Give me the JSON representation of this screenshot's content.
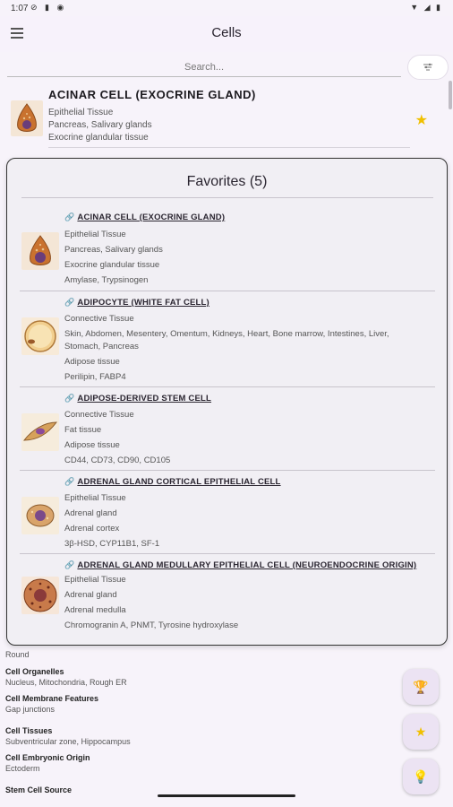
{
  "status_bar": {
    "time": "1:07"
  },
  "app_bar": {
    "title": "Cells",
    "menu_icon": "menu-icon"
  },
  "search": {
    "placeholder": "Search...",
    "filter_icon": "filter-icon"
  },
  "current_cell": {
    "name": "ACINAR CELL (EXOCRINE GLAND)",
    "tissue": "Epithelial Tissue",
    "location": "Pancreas, Salivary glands",
    "type": "Exocrine glandular tissue",
    "favorite_icon": "star-icon",
    "favorite_color": "#f0c000"
  },
  "favorites": {
    "title": "Favorites (5)",
    "items": [
      {
        "name": "ACINAR CELL (EXOCRINE GLAND)",
        "tissue": "Epithelial Tissue",
        "location": "Pancreas, Salivary glands",
        "type": "Exocrine glandular tissue",
        "markers": "Amylase, Trypsinogen",
        "icon": "acinar-cell-icon"
      },
      {
        "name": "ADIPOCYTE (WHITE FAT CELL)",
        "tissue": "Connective Tissue",
        "location": "Skin, Abdomen, Mesentery, Omentum, Kidneys, Heart, Bone marrow, Intestines, Liver,",
        "location_2": "Stomach, Pancreas",
        "type": "Adipose tissue",
        "markers": "Perilipin, FABP4",
        "icon": "adipocyte-icon"
      },
      {
        "name": "ADIPOSE-DERIVED STEM CELL",
        "tissue": "Connective Tissue",
        "location": "Fat tissue",
        "type": "Adipose tissue",
        "markers": "CD44, CD73, CD90, CD105",
        "icon": "stem-cell-icon"
      },
      {
        "name": "ADRENAL GLAND CORTICAL EPITHELIAL CELL",
        "tissue": "Epithelial Tissue",
        "location": "Adrenal gland",
        "type": "Adrenal cortex",
        "markers": "3β-HSD, CYP11B1, SF-1",
        "icon": "adrenal-cortical-cell-icon"
      },
      {
        "name": "ADRENAL GLAND MEDULLARY EPITHELIAL CELL (NEUROENDOCRINE ORIGIN)",
        "tissue": "Epithelial Tissue",
        "location": "Adrenal gland",
        "type": "Adrenal medulla",
        "markers": "Chromogranin A, PNMT, Tyrosine hydroxylase",
        "icon": "adrenal-medullary-cell-icon"
      }
    ]
  },
  "details": {
    "shape_value": "Round",
    "organelles_label": "Cell Organelles",
    "organelles_value": "Nucleus, Mitochondria, Rough ER",
    "membrane_label": "Cell Membrane Features",
    "membrane_value": "Gap junctions",
    "tissues_label": "Cell Tissues",
    "tissues_value": "Subventricular zone, Hippocampus",
    "origin_label": "Cell Embryonic Origin",
    "origin_value": "Ectoderm",
    "stem_label": "Stem Cell Source"
  },
  "fabs": {
    "trophy_icon": "trophy-icon",
    "star_icon": "star-icon",
    "bulb_icon": "lightbulb-icon"
  }
}
